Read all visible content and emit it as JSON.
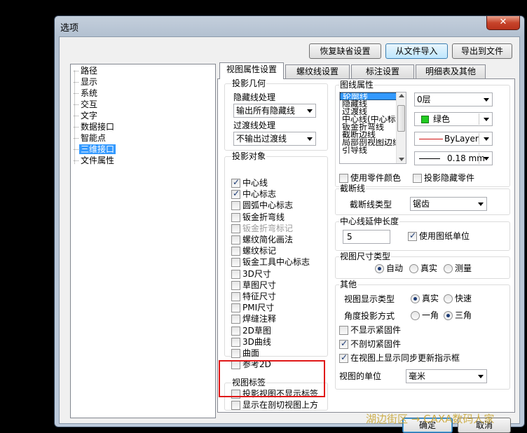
{
  "window": {
    "title": "选项",
    "close_glyph": "✕"
  },
  "toolbar": {
    "restore": "恢复缺省设置",
    "import": "从文件导入",
    "export": "导出到文件"
  },
  "tree": {
    "items": [
      "路径",
      "显示",
      "系统",
      "交互",
      "文字",
      "数据接口",
      "智能点",
      "三维接口",
      "文件属性"
    ],
    "selected": "三维接口"
  },
  "tabs": [
    "视图属性设置",
    "螺纹线设置",
    "标注设置",
    "明细表及其他"
  ],
  "projection_geometry": {
    "title": "投影几何",
    "hidden_label": "隐藏线处理",
    "hidden_value": "输出所有隐藏线",
    "transition_label": "过渡线处理",
    "transition_value": "不输出过渡线"
  },
  "projection_objects": {
    "title": "投影对象",
    "items": [
      {
        "label": "中心线",
        "checked": true,
        "disabled": false
      },
      {
        "label": "中心标志",
        "checked": true,
        "disabled": false
      },
      {
        "label": "圆弧中心标志",
        "checked": false,
        "disabled": false
      },
      {
        "label": "钣金折弯线",
        "checked": false,
        "disabled": false
      },
      {
        "label": "钣金折弯标记",
        "checked": false,
        "disabled": true
      },
      {
        "label": "螺纹简化画法",
        "checked": false,
        "disabled": false
      },
      {
        "label": "螺纹标记",
        "checked": false,
        "disabled": false
      },
      {
        "label": "钣金工具中心标志",
        "checked": false,
        "disabled": false
      },
      {
        "label": "3D尺寸",
        "checked": false,
        "disabled": false
      },
      {
        "label": "草图尺寸",
        "checked": false,
        "disabled": false
      },
      {
        "label": "特征尺寸",
        "checked": false,
        "disabled": false
      },
      {
        "label": "PMI尺寸",
        "checked": false,
        "disabled": false
      },
      {
        "label": "焊缝注释",
        "checked": false,
        "disabled": false
      },
      {
        "label": "2D草图",
        "checked": false,
        "disabled": false
      },
      {
        "label": "3D曲线",
        "checked": false,
        "disabled": false
      },
      {
        "label": "曲面",
        "checked": false,
        "disabled": false
      },
      {
        "label": "参考2D",
        "checked": false,
        "disabled": false
      }
    ]
  },
  "view_label": {
    "title": "视图标签",
    "hide_in_projection": "投影视图不显示标签",
    "show_above_section": "显示在剖切视图上方"
  },
  "line_props": {
    "title": "图线属性",
    "list": [
      "轮廓线",
      "隐藏线",
      "过渡线",
      "中心线(中心标",
      "钣金折弯线",
      "截断边线",
      "局部剖视图边线",
      "引导线"
    ],
    "selected": "轮廓线",
    "layer": "0层",
    "color_name": "绿色",
    "color_hex": "#22cc22",
    "linetype": "ByLayer",
    "linewidth": "0.18 mm",
    "use_part_color": "使用零件颜色",
    "hidden_parts": "投影隐藏零件"
  },
  "break_line": {
    "title": "截断线",
    "type_label": "截断线类型",
    "type_value": "锯齿"
  },
  "center_ext": {
    "title": "中心线延伸长度",
    "value": "5",
    "use_paper_units": "使用图纸单位"
  },
  "dim_type": {
    "title": "视图尺寸类型",
    "options": [
      "自动",
      "真实",
      "测量"
    ],
    "selected": "自动"
  },
  "other": {
    "title": "其他",
    "display_type_label": "视图显示类型",
    "display_options": [
      "真实",
      "快速"
    ],
    "display_selected": "真实",
    "angle_label": "角度投影方式",
    "angle_options": [
      "一角",
      "三角"
    ],
    "angle_selected": "三角",
    "no_fasteners": "不显示紧固件",
    "no_cut_fasteners": "不剖切紧固件",
    "sync_indicator": "在视图上显示同步更新指示框",
    "unit_label": "视图的单位",
    "unit_value": "毫米"
  },
  "footer": {
    "ok": "确定",
    "cancel": "取消"
  },
  "watermark": "湖边街区 → CAXA数码人家"
}
